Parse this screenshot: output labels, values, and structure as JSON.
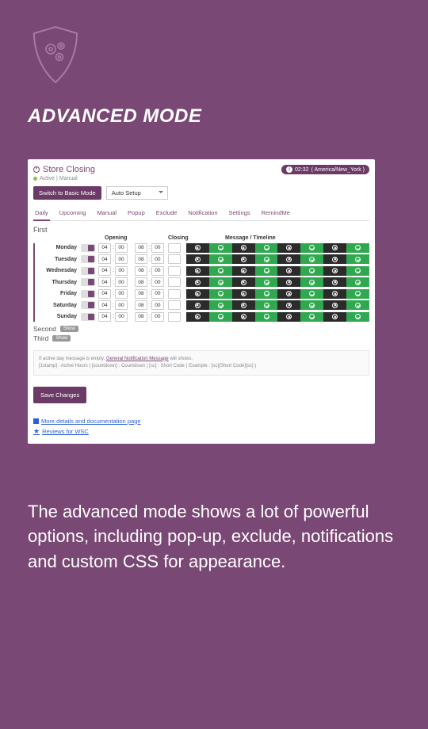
{
  "hero": {
    "title": "ADVANCED MODE",
    "caption": "The advanced mode shows a lot of powerful options, including pop-up, exclude, notifications and custom CSS for appearance."
  },
  "panel": {
    "title": "Store Closing",
    "status": "Active | Manual",
    "timezone": {
      "time": "02:32",
      "zone": "( America/New_York )"
    },
    "switch_label": "Switch to Basic Mode",
    "auto_setup_label": "Auto Setup",
    "tabs": [
      "Daily",
      "Upcoming",
      "Manual",
      "Popup",
      "Exclude",
      "Notification",
      "Settings",
      "RemindMe"
    ],
    "section_first": "First",
    "section_second": "Second",
    "section_third": "Third",
    "show_label": "Show",
    "headers": {
      "opening": "Opening",
      "closing": "Closing",
      "msgtl": "Message / Timeline"
    },
    "days": [
      {
        "name": "Monday",
        "oh": "04",
        "om": "00",
        "ch": "08",
        "cm": "00"
      },
      {
        "name": "Tuesday",
        "oh": "04",
        "om": "00",
        "ch": "08",
        "cm": "00"
      },
      {
        "name": "Wednesday",
        "oh": "04",
        "om": "00",
        "ch": "08",
        "cm": "00"
      },
      {
        "name": "Thursday",
        "oh": "04",
        "om": "00",
        "ch": "08",
        "cm": "00"
      },
      {
        "name": "Friday",
        "oh": "04",
        "om": "00",
        "ch": "08",
        "cm": "00"
      },
      {
        "name": "Saturday",
        "oh": "04",
        "om": "00",
        "ch": "08",
        "cm": "00"
      },
      {
        "name": "Sunday",
        "oh": "04",
        "om": "00",
        "ch": "08",
        "cm": "00"
      }
    ],
    "note_line1_a": "If active day message is empty, ",
    "note_line1_link": "General Notification Message",
    "note_line1_b": " will shows.",
    "note_line2": "[1stamp] : Active Hours | [countdown] : Countdown | [sc] : Short Code ( Example : [sc]{Short Code}[sc] )",
    "save_label": "Save Changes",
    "footer_docs": "More details and documentation page",
    "footer_reviews": "Reviews for WSC"
  }
}
